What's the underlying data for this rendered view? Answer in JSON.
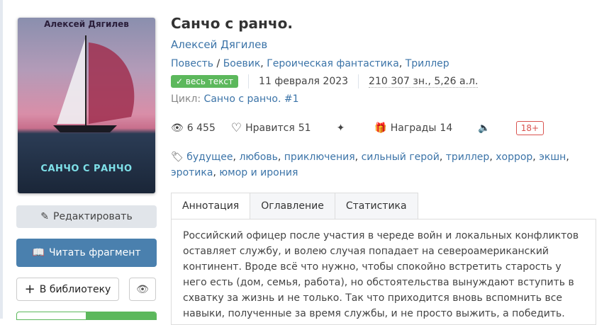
{
  "cover": {
    "author": "Алексей Дягилев",
    "title": "САНЧО С РАНЧО"
  },
  "buttons": {
    "edit": "Редактировать",
    "read": "Читать фрагмент",
    "library": "В библиотеку"
  },
  "book": {
    "title": "Санчо с ранчо.",
    "author": "Алексей Дягилев",
    "form": "Повесть",
    "genres": [
      "Боевик",
      "Героическая фантастика",
      "Триллер"
    ],
    "status": "весь текст",
    "date": "11 февраля 2023",
    "size": "210 307 зн., 5,26 а.л.",
    "cycle_label": "Цикл:",
    "cycle": "Санчо с ранчо. #1"
  },
  "stats": {
    "views": "6 455",
    "likes_label": "Нравится",
    "likes": "51",
    "awards_label": "Награды",
    "awards": "14",
    "age": "18+"
  },
  "tags": [
    "будущее",
    "любовь",
    "приключения",
    "сильный герой",
    "триллер",
    "хоррор",
    "экшн",
    "эротика",
    "юмор и ирония"
  ],
  "tabs": [
    "Аннотация",
    "Оглавление",
    "Статистика"
  ],
  "annotation": "Российский офицер после участия в череде войн и локальных конфликтов оставляет службу, и волею случая попадает на североамериканский континент. Вроде всё что нужно, чтобы спокойно встретить старость у него есть (дом, семья, работа), но обстоятельства вынуждают вступить в схватку за жизнь и не только. Так что приходится вновь вспомнить все навыки, полученные за время службы, и не просто выжить, а победить."
}
